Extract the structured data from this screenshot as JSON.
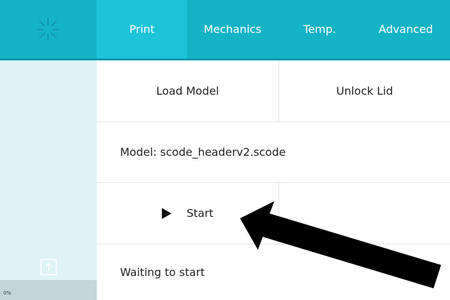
{
  "sidebar": {
    "logo_icon": "starburst-logo-icon",
    "upload_icon": "upload-icon",
    "progress_text": "0%",
    "progress_value": 0
  },
  "nav": {
    "tabs": [
      {
        "label": "Print",
        "active": true
      },
      {
        "label": "Mechanics",
        "active": false
      },
      {
        "label": "Temp.",
        "active": false
      },
      {
        "label": "Advanced",
        "active": false
      }
    ]
  },
  "main": {
    "load_model_label": "Load Model",
    "unlock_lid_label": "Unlock Lid",
    "model_label": "Model: scode_headerv2.scode",
    "start_label": "Start",
    "status_text": "Waiting to start"
  },
  "colors": {
    "accent": "#15b3c6",
    "active_tab": "#1dc4d9",
    "sidebar_bg": "#dff3f7"
  }
}
